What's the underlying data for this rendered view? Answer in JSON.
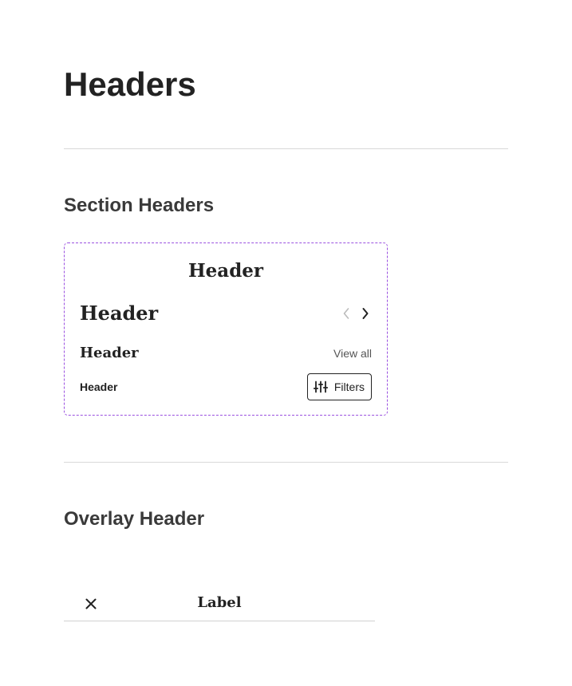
{
  "page": {
    "title": "Headers"
  },
  "sections": {
    "section_headers": {
      "title": "Section Headers"
    },
    "overlay_header": {
      "title": "Overlay Header"
    }
  },
  "demo": {
    "centered_header": "Header",
    "nav_header": "Header",
    "view_all_header": "Header",
    "view_all_link": "View all",
    "filters_header": "Header",
    "filters_button": "Filters",
    "icons": {
      "prev": "chevron-left-icon",
      "next": "chevron-right-icon",
      "filters": "sliders-icon"
    }
  },
  "overlay": {
    "label": "Label",
    "close_icon": "close-icon"
  },
  "colors": {
    "frame_dashed": "#9b51e0",
    "text": "#222222",
    "muted": "#555555",
    "disabled": "#bbbbbb",
    "divider": "#d9d9d9"
  }
}
